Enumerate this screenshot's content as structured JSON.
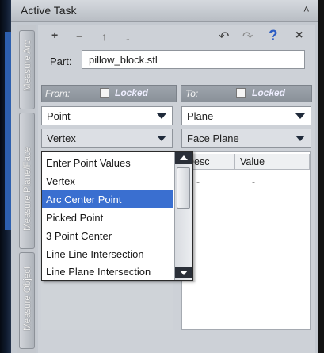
{
  "panel": {
    "title": "Active Task"
  },
  "vertical_tabs": [
    {
      "label": "Measure Arc"
    },
    {
      "label": "Measure Plane/Face"
    },
    {
      "label": "Measure Object"
    }
  ],
  "toolbar": {
    "add_icon": "+",
    "minus_icon": "−",
    "up_icon": "↑",
    "down_icon": "↓",
    "undo_icon": "↶",
    "redo_icon": "↷",
    "help_icon": "?",
    "close_icon": "×"
  },
  "part": {
    "label": "Part:",
    "value": "pillow_block.stl"
  },
  "from": {
    "title": "From:",
    "locked_label": "Locked",
    "type_value": "Point",
    "method_value": "Vertex"
  },
  "to": {
    "title": "To:",
    "locked_label": "Locked",
    "type_value": "Plane",
    "method_value": "Face Plane",
    "columns": [
      "Desc",
      "Value"
    ],
    "rows": [
      {
        "desc": "-",
        "value": "-"
      }
    ]
  },
  "dropdown": {
    "items": [
      "Enter Point Values",
      "Vertex",
      "Arc Center Point",
      "Picked Point",
      "3 Point Center",
      "Line Line Intersection",
      "Line Plane Intersection"
    ],
    "selected_index": 2
  },
  "colors": {
    "selection": "#3a6fd0",
    "help_icon": "#2b5cc4",
    "panel_bg": "#c4c9d0"
  }
}
